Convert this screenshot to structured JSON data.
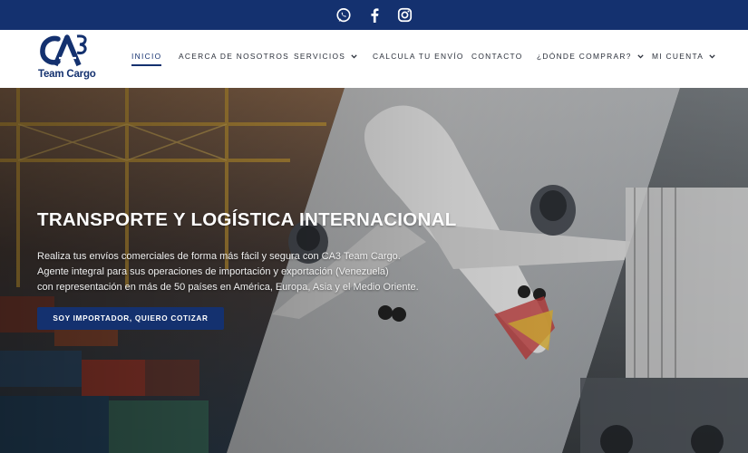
{
  "topbar": {
    "icons": [
      "whatsapp-icon",
      "facebook-icon",
      "instagram-icon"
    ],
    "bg_color": "#14316f"
  },
  "brand": {
    "logo_mark": "CA3",
    "logo_text": "Team Cargo",
    "color": "#14316f"
  },
  "nav": {
    "items": [
      {
        "label": "INICIO",
        "active": true
      },
      {
        "label": "ACERCA DE NOSOTROS"
      },
      {
        "label": "SERVICIOS",
        "dropdown": true
      },
      {
        "label": "CALCULA TU ENVÍO"
      },
      {
        "label": "CONTACTO"
      },
      {
        "label": "¿DÓNDE COMPRAR?",
        "dropdown": true
      },
      {
        "label": "MI CUENTA",
        "dropdown": true
      }
    ]
  },
  "hero": {
    "title": "TRANSPORTE Y LOGÍSTICA INTERNACIONAL",
    "lines": [
      "Realiza tus envíos comerciales de forma más fácil y segura con CA3 Team Cargo.",
      "Agente integral para sus operaciones de importación y exportación (Venezuela)",
      "con representación en más de 50 países en América, Europa, Asia y el Medio Oriente."
    ],
    "cta_label": "SOY IMPORTADOR, QUIERO COTIZAR"
  }
}
